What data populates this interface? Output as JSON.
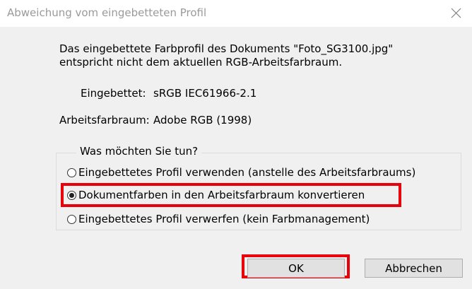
{
  "window": {
    "title": "Abweichung vom eingebetteten Profil"
  },
  "message": {
    "line1": "Das eingebettete Farbprofil des Dokuments \"Foto_SG3100.jpg\"",
    "line2": "entspricht nicht dem aktuellen RGB-Arbeitsfarbraum."
  },
  "embedded": {
    "label": "Eingebettet:",
    "value": "sRGB IEC61966-2.1"
  },
  "working": {
    "label": "Arbeitsfarbraum:",
    "value": "Adobe RGB (1998)"
  },
  "options": {
    "legend": "Was möchten Sie tun?",
    "items": [
      {
        "label": "Eingebettetes Profil verwenden (anstelle des Arbeitsfarbraums)",
        "checked": false
      },
      {
        "label": "Dokumentfarben in den Arbeitsfarbraum konvertieren",
        "checked": true
      },
      {
        "label": "Eingebettetes Profil verwerfen (kein Farbmanagement)",
        "checked": false
      }
    ]
  },
  "buttons": {
    "ok": "OK",
    "cancel": "Abbrechen"
  },
  "colors": {
    "highlight": "#e8000a",
    "background": "#f0f0f0",
    "button": "#e1e1e1"
  },
  "icons": {
    "close": "close-icon"
  }
}
